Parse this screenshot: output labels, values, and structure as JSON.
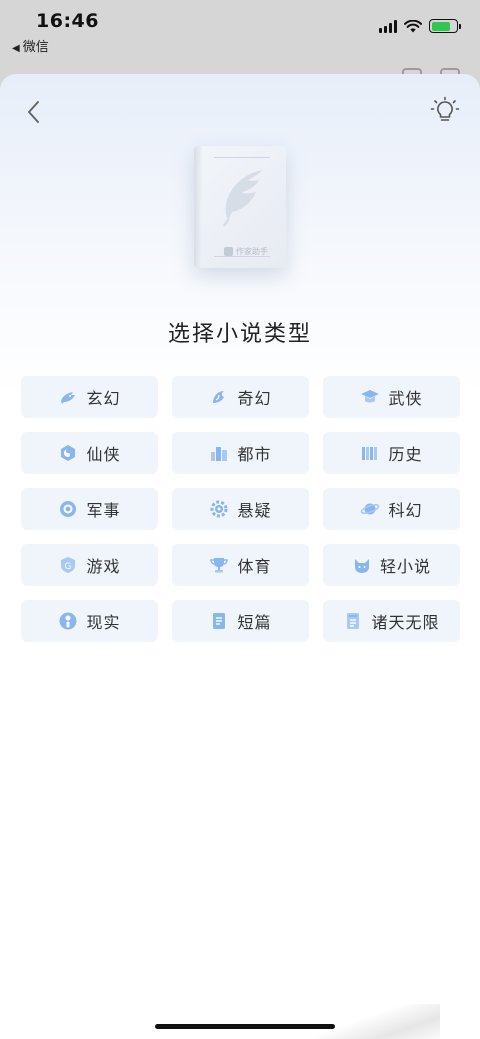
{
  "status_bar": {
    "time": "16:46",
    "back_app": "微信",
    "battery_color": "#31c653"
  },
  "sheet": {
    "title": "选择小说类型",
    "book_brand": "作家助手",
    "back_icon": "chevron-left-icon",
    "hint_icon": "lightbulb-icon"
  },
  "genres": [
    {
      "label": "玄幻",
      "icon": "dragon-icon"
    },
    {
      "label": "奇幻",
      "icon": "phoenix-icon"
    },
    {
      "label": "武侠",
      "icon": "scholar-hat-icon"
    },
    {
      "label": "仙侠",
      "icon": "yin-yang-icon"
    },
    {
      "label": "都市",
      "icon": "city-icon"
    },
    {
      "label": "历史",
      "icon": "bamboo-scroll-icon"
    },
    {
      "label": "军事",
      "icon": "military-badge-icon"
    },
    {
      "label": "悬疑",
      "icon": "gear-eye-icon"
    },
    {
      "label": "科幻",
      "icon": "planet-icon"
    },
    {
      "label": "游戏",
      "icon": "game-shield-icon"
    },
    {
      "label": "体育",
      "icon": "trophy-icon"
    },
    {
      "label": "轻小说",
      "icon": "cat-icon"
    },
    {
      "label": "现实",
      "icon": "person-icon"
    },
    {
      "label": "短篇",
      "icon": "document-icon"
    },
    {
      "label": "诸天无限",
      "icon": "document-lines-icon"
    }
  ],
  "accent_color": "#6ea8f0",
  "tile_color": "#f0f5fc"
}
